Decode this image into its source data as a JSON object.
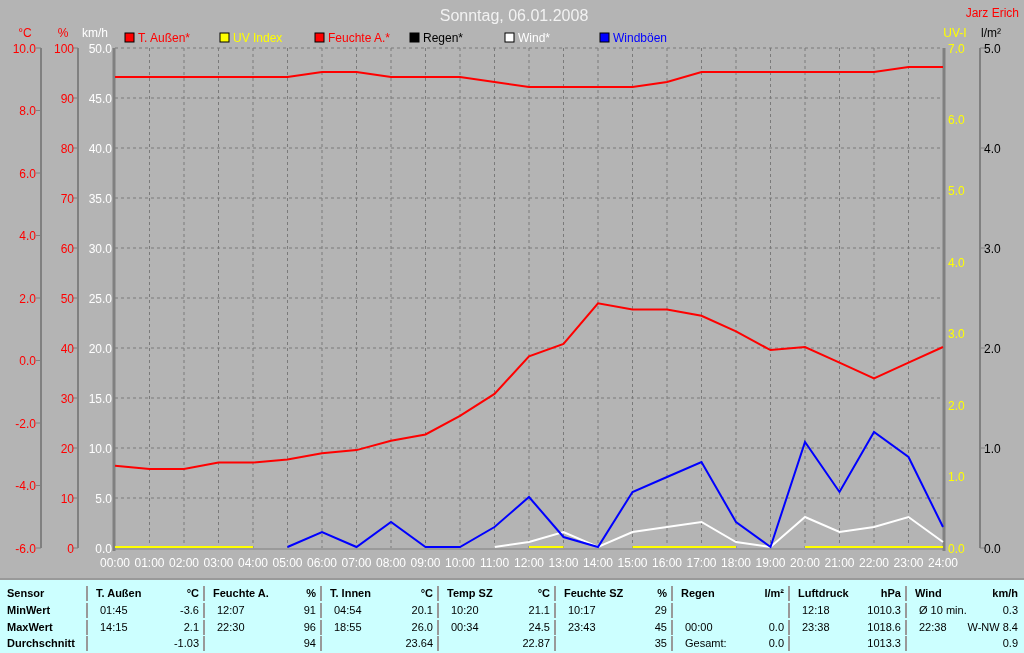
{
  "author": "Jarz Erich",
  "axes": [
    {
      "unit": "UV-I",
      "ticks": [
        "7.0",
        "6.0",
        "5.0",
        "4.0",
        "3.0",
        "2.0",
        "1.0",
        "0.0"
      ]
    },
    {
      "unit": "l/m²",
      "ticks": [
        "5.0",
        "4.0",
        "3.0",
        "2.0",
        "1.0",
        "0.0"
      ]
    }
  ],
  "chart_data": {
    "type": "line",
    "title": "Sonntag, 06.01.2008",
    "grid": true,
    "legend": true,
    "y2label": "°C",
    "y2lim": [
      -6,
      10
    ],
    "y2ticks": [
      {
        "value": 10,
        "label": "10.0"
      },
      {
        "value": 8,
        "label": "8.0"
      },
      {
        "value": 6,
        "label": "6.0"
      },
      {
        "value": 4,
        "label": "4.0"
      },
      {
        "value": 2,
        "label": "2.0"
      },
      {
        "value": 0,
        "label": "0.0"
      },
      {
        "value": -2,
        "label": "-2.0"
      },
      {
        "value": -4,
        "label": "-4.0"
      },
      {
        "value": -6,
        "label": "-6.0"
      }
    ],
    "y3label": "%",
    "y3lim": [
      0,
      100
    ],
    "y3ticks": [
      100,
      90,
      80,
      70,
      60,
      50,
      40,
      30,
      20,
      10,
      0
    ],
    "ylabel": "km/h",
    "ylim": [
      0,
      50
    ],
    "yticks": [
      {
        "value": 50,
        "label": "50.0"
      },
      {
        "value": 45,
        "label": "45.0"
      },
      {
        "value": 40,
        "label": "40.0"
      },
      {
        "value": 35,
        "label": "35.0"
      },
      {
        "value": 30,
        "label": "30.0"
      },
      {
        "value": 25,
        "label": "25.0"
      },
      {
        "value": 20,
        "label": "20.0"
      },
      {
        "value": 15,
        "label": "15.0"
      },
      {
        "value": 10,
        "label": "10.0"
      },
      {
        "value": 5,
        "label": "5.0"
      },
      {
        "value": 0,
        "label": "0.0"
      }
    ],
    "categories": [
      "00:00",
      "01:00",
      "02:00",
      "03:00",
      "04:00",
      "05:00",
      "06:00",
      "07:00",
      "08:00",
      "09:00",
      "10:00",
      "11:00",
      "12:00",
      "13:00",
      "14:00",
      "15:00",
      "16:00",
      "17:00",
      "18:00",
      "19:00",
      "20:00",
      "21:00",
      "22:00",
      "23:00",
      "24:00"
    ],
    "series": [
      {
        "name": "T. Außen*",
        "color": "#ff0000",
        "axis": "y2",
        "values": [
          -3.4,
          -3.5,
          -3.5,
          -3.3,
          -3.3,
          -3.2,
          -3.0,
          -2.9,
          -2.6,
          -2.4,
          -1.8,
          -1.1,
          0.1,
          0.5,
          1.8,
          1.6,
          1.6,
          1.4,
          0.9,
          0.3,
          0.4,
          -0.1,
          -0.6,
          -0.1,
          0.4
        ]
      },
      {
        "name": "UV Index",
        "color": "#ffff00",
        "values": [
          0,
          0,
          0,
          0,
          0,
          null,
          null,
          null,
          null,
          null,
          null,
          null,
          0,
          0,
          null,
          0,
          0,
          0,
          0,
          null,
          0,
          0,
          0,
          0,
          0
        ]
      },
      {
        "name": "Feuchte A.*",
        "color": "#ff0000",
        "axis": "y3",
        "values": [
          94,
          94,
          94,
          94,
          94,
          94,
          95,
          95,
          94,
          94,
          94,
          93,
          92,
          92,
          92,
          92,
          93,
          95,
          95,
          95,
          95,
          95,
          95,
          96,
          96
        ]
      },
      {
        "name": "Regen*",
        "color": "#000000",
        "values": [
          null,
          null,
          null,
          null,
          null,
          null,
          null,
          null,
          null,
          null,
          null,
          null,
          null,
          null,
          null,
          null,
          null,
          null,
          null,
          null,
          null,
          null,
          null,
          null,
          null
        ]
      },
      {
        "name": "Wind*",
        "color": "#ffffff",
        "values": [
          null,
          null,
          null,
          null,
          null,
          null,
          null,
          null,
          null,
          null,
          null,
          0,
          0.5,
          1.5,
          0,
          1.5,
          2,
          2.5,
          0.5,
          0,
          3,
          1.5,
          2,
          3,
          0.5
        ]
      },
      {
        "name": "Windböen",
        "color": "#0000ff",
        "values": [
          null,
          null,
          null,
          null,
          null,
          0,
          1.5,
          0,
          2.5,
          0,
          0,
          2,
          5,
          1,
          0,
          5.5,
          7,
          8.5,
          2.5,
          0,
          10.5,
          5.5,
          11.5,
          9,
          2
        ]
      }
    ]
  },
  "table": {
    "row_labels": [
      "Sensor",
      "MinWert",
      "MaxWert",
      "Durchschnitt"
    ],
    "groups": [
      {
        "name": "T. Außen",
        "unit": "°C",
        "rows": [
          {
            "label": "01:45",
            "value": "-3.6"
          },
          {
            "label": "14:15",
            "value": "2.1"
          },
          {
            "value": "-1.03"
          }
        ]
      },
      {
        "name": "Feuchte A.",
        "unit": "%",
        "rows": [
          {
            "label": "12:07",
            "value": "91"
          },
          {
            "label": "22:30",
            "value": "96"
          },
          {
            "value": "94"
          }
        ]
      },
      {
        "name": "T. Innen",
        "unit": "°C",
        "rows": [
          {
            "label": "04:54",
            "value": "20.1"
          },
          {
            "label": "18:55",
            "value": "26.0"
          },
          {
            "value": "23.64"
          }
        ]
      },
      {
        "name": "Temp SZ",
        "unit": "°C",
        "rows": [
          {
            "label": "10:20",
            "value": "21.1"
          },
          {
            "label": "00:34",
            "value": "24.5"
          },
          {
            "value": "22.87"
          }
        ]
      },
      {
        "name": "Feuchte SZ",
        "unit": "%",
        "rows": [
          {
            "label": "10:17",
            "value": "29"
          },
          {
            "label": "23:43",
            "value": "45"
          },
          {
            "value": "35"
          }
        ]
      },
      {
        "name": "Regen",
        "unit": "l/m²",
        "rows": [
          {},
          {
            "label": "00:00",
            "value": "0.0"
          },
          {
            "label": "Gesamt:",
            "value": "0.0"
          }
        ]
      },
      {
        "name": "Luftdruck",
        "unit": "hPa",
        "rows": [
          {
            "label": "12:18",
            "value": "1010.3"
          },
          {
            "label": "23:38",
            "value": "1018.6"
          },
          {
            "value": "1013.3"
          }
        ]
      },
      {
        "name": "Wind",
        "unit": "km/h",
        "rows": [
          {
            "label": "Ø 10 min.",
            "value": "0.3"
          },
          {
            "label": "22:38",
            "value": "W-NW 8.4"
          },
          {
            "value": "0.9"
          }
        ]
      }
    ]
  }
}
